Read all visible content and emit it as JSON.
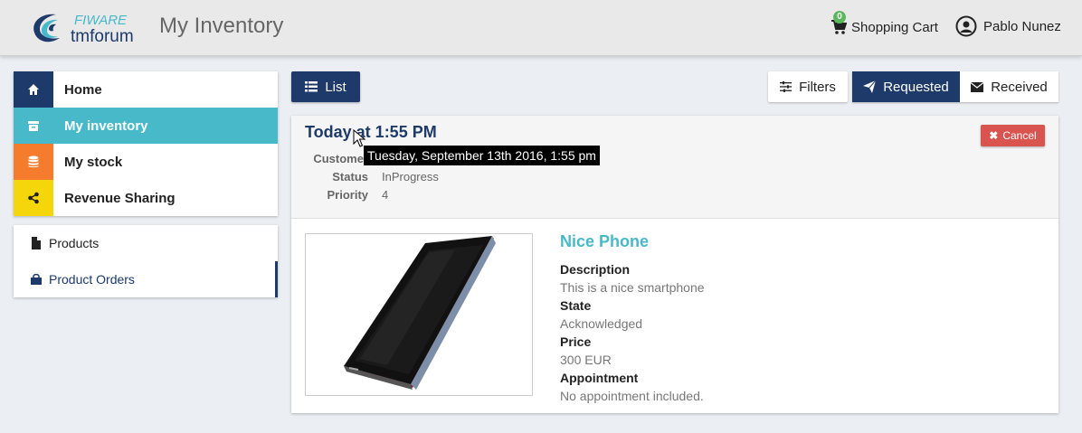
{
  "header": {
    "logo_text_top": "FIWARE",
    "logo_text_bottom": "tmforum",
    "title": "My Inventory",
    "cart_count": "0",
    "cart_label": "Shopping Cart",
    "user_name": "Pablo Nunez"
  },
  "sidebar": {
    "main": [
      {
        "label": "Home",
        "icon": "home-icon",
        "color": "#1e3a6a"
      },
      {
        "label": "My inventory",
        "icon": "archive-icon",
        "color": "#47b9c9"
      },
      {
        "label": "My stock",
        "icon": "database-icon",
        "color": "#f47c2c"
      },
      {
        "label": "Revenue Sharing",
        "icon": "share-icon",
        "color": "#f5d60a"
      }
    ],
    "sub": [
      {
        "label": "Products",
        "icon": "file-icon"
      },
      {
        "label": "Product Orders",
        "icon": "shopping-bag-icon"
      }
    ]
  },
  "toolbar": {
    "list_label": "List",
    "filters_label": "Filters",
    "requested_label": "Requested",
    "received_label": "Received"
  },
  "order": {
    "date": "Today at 1:55 PM",
    "tooltip": "Tuesday, September 13th 2016, 1:55 pm",
    "customer_label": "Customer",
    "status_label": "Status",
    "status_value": "InProgress",
    "priority_label": "Priority",
    "priority_value": "4",
    "cancel_label": "Cancel"
  },
  "product": {
    "name": "Nice Phone",
    "description_label": "Description",
    "description_value": "This is a nice smartphone",
    "state_label": "State",
    "state_value": "Acknowledged",
    "price_label": "Price",
    "price_value": "300 EUR",
    "appointment_label": "Appointment",
    "appointment_value": "No appointment included."
  },
  "colors": {
    "primary": "#1e3a6a",
    "accent": "#47b9c9",
    "danger": "#d9534f",
    "success": "#5cb85c"
  }
}
